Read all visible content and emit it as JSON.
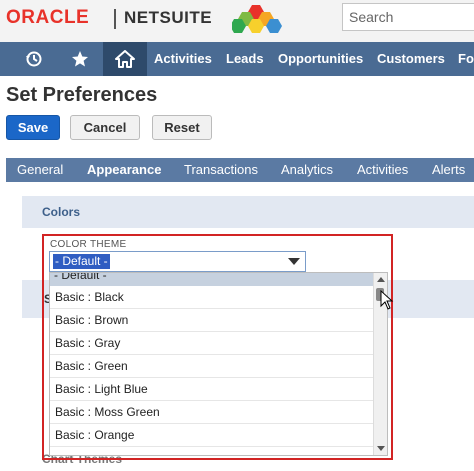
{
  "brand": {
    "oracle": "ORACLE",
    "netsuite": "NETSUITE"
  },
  "search": {
    "placeholder": "Search"
  },
  "nav": {
    "items": [
      "Activities",
      "Leads",
      "Opportunities",
      "Customers",
      "Fo"
    ]
  },
  "page": {
    "title": "Set Preferences"
  },
  "buttons": {
    "save": "Save",
    "cancel": "Cancel",
    "reset": "Reset"
  },
  "subtabs": [
    "General",
    "Appearance",
    "Transactions",
    "Analytics",
    "Activities",
    "Alerts"
  ],
  "section": {
    "colors": "Colors",
    "partial_s": "S",
    "partial_chart": "Chart Themes"
  },
  "color_theme": {
    "label": "COLOR THEME",
    "selected": "- Default -",
    "options": [
      "- Default -",
      "Basic : Black",
      "Basic : Brown",
      "Basic : Gray",
      "Basic : Green",
      "Basic : Light Blue",
      "Basic : Moss Green",
      "Basic : Orange"
    ]
  },
  "colors": {
    "nav_bg": "#4a6b93",
    "subtab_bg": "#5b7aa3",
    "accent": "#1b67c8",
    "highlight": "#d22424"
  }
}
